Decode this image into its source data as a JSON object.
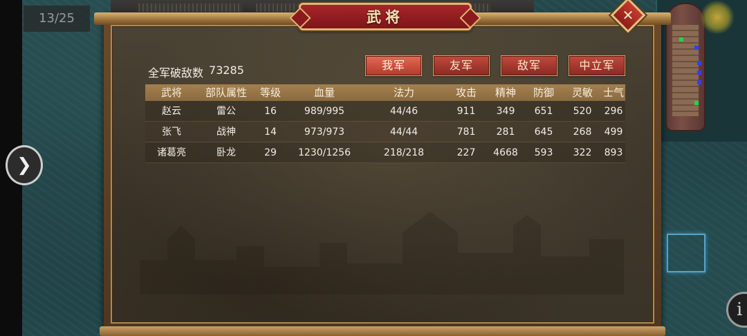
{
  "hud": {
    "turn_counter": "13/25"
  },
  "dialog": {
    "title": "武将",
    "close_icon": "close-x-icon",
    "kills_label": "全军破敌数",
    "kills_value": "73285",
    "filters": [
      "我军",
      "友军",
      "敌军",
      "中立军"
    ],
    "active_filter": "我军",
    "table": {
      "headers": [
        "武将",
        "部队属性",
        "等级",
        "血量",
        "法力",
        "攻击",
        "精神",
        "防御",
        "灵敏",
        "士气"
      ],
      "rows": [
        [
          "赵云",
          "雷公",
          "16",
          "989/995",
          "44/46",
          "911",
          "349",
          "651",
          "520",
          "296"
        ],
        [
          "张飞",
          "战神",
          "14",
          "973/973",
          "44/44",
          "781",
          "281",
          "645",
          "268",
          "499"
        ],
        [
          "诸葛亮",
          "卧龙",
          "29",
          "1230/1256",
          "218/218",
          "227",
          "4668",
          "593",
          "322",
          "893"
        ]
      ]
    }
  },
  "colors": {
    "accent_red": "#b3392c",
    "frame_gold": "#e0b676",
    "panel_bg": "#3f382b"
  }
}
